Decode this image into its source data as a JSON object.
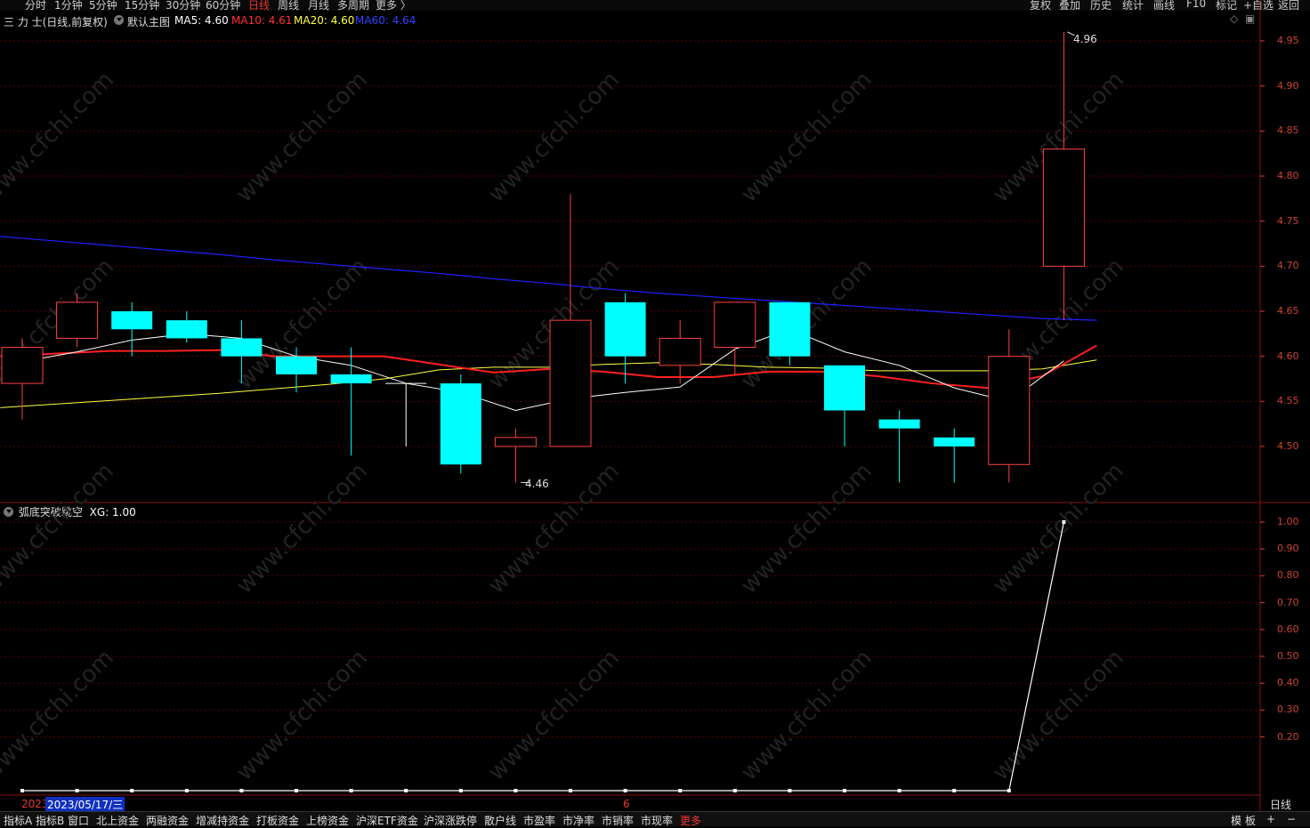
{
  "toolbar": {
    "periods": [
      "分时",
      "1分钟",
      "5分钟",
      "15分钟",
      "30分钟",
      "60分钟",
      "日线",
      "周线",
      "月线",
      "多周期",
      "更多 〉"
    ],
    "active_period": "日线",
    "right_buttons": [
      "复权",
      "叠加",
      "历史",
      "统计",
      "画线",
      "F10",
      "标记",
      "+自选",
      "返回"
    ]
  },
  "stock": {
    "title": "三 力 士(日线,前复权)",
    "main_label": "默认主图",
    "ma5": "MA5: 4.60",
    "ma10": "MA10: 4.61",
    "ma20": "MA20: 4.60",
    "ma60": "MA60: 4.64"
  },
  "indicator": {
    "title": "弧底突破跳空",
    "value": "XG: 1.00"
  },
  "annotations": {
    "high": "4.96",
    "low": "4.46"
  },
  "dates": {
    "left_year": "2023",
    "cursor_date": "2023/05/17/三",
    "month_mark": "6"
  },
  "right_panel": {
    "period_label": "日线"
  },
  "bottom_tabs": [
    "指标A",
    "指标B",
    "窗口",
    "北上资金",
    "两融资金",
    "增减持资金",
    "打板资金",
    "上榜资金",
    "沪深ETF资金",
    "沪深涨跌停",
    "散户线",
    "市盈率",
    "市净率",
    "市销率",
    "市现率",
    "更多"
  ],
  "bottom_right": [
    "模",
    "板",
    "+",
    "−"
  ],
  "watermark": "www.cfchi.com",
  "colors": {
    "up": "#ff4040",
    "down": "#00ffff",
    "ma5": "#ffffff",
    "ma10": "#ff2020",
    "ma20": "#ffff40",
    "ma60": "#2020ff",
    "grid": "#5a0000"
  },
  "chart_data": [
    {
      "type": "candlestick",
      "y_ticks": [
        "4.95",
        "4.90",
        "4.85",
        "4.80",
        "4.75",
        "4.70",
        "4.65",
        "4.60",
        "4.55",
        "4.50"
      ],
      "ylim": [
        4.44,
        4.97
      ],
      "candles": [
        {
          "o": 4.57,
          "c": 4.61,
          "h": 4.62,
          "l": 4.53
        },
        {
          "o": 4.62,
          "c": 4.66,
          "h": 4.67,
          "l": 4.61
        },
        {
          "o": 4.65,
          "c": 4.63,
          "h": 4.66,
          "l": 4.6
        },
        {
          "o": 4.64,
          "c": 4.62,
          "h": 4.65,
          "l": 4.615
        },
        {
          "o": 4.62,
          "c": 4.6,
          "h": 4.64,
          "l": 4.57
        },
        {
          "o": 4.6,
          "c": 4.58,
          "h": 4.61,
          "l": 4.56
        },
        {
          "o": 4.58,
          "c": 4.57,
          "h": 4.61,
          "l": 4.49
        },
        {
          "o": 4.57,
          "c": 4.57,
          "h": 4.57,
          "l": 4.5
        },
        {
          "o": 4.57,
          "c": 4.48,
          "h": 4.58,
          "l": 4.47
        },
        {
          "o": 4.5,
          "c": 4.51,
          "h": 4.52,
          "l": 4.46
        },
        {
          "o": 4.5,
          "c": 4.64,
          "h": 4.78,
          "l": 4.5
        },
        {
          "o": 4.66,
          "c": 4.6,
          "h": 4.67,
          "l": 4.57
        },
        {
          "o": 4.59,
          "c": 4.62,
          "h": 4.64,
          "l": 4.57
        },
        {
          "o": 4.61,
          "c": 4.66,
          "h": 4.66,
          "l": 4.58
        },
        {
          "o": 4.66,
          "c": 4.6,
          "h": 4.66,
          "l": 4.59
        },
        {
          "o": 4.59,
          "c": 4.54,
          "h": 4.59,
          "l": 4.5
        },
        {
          "o": 4.53,
          "c": 4.52,
          "h": 4.54,
          "l": 4.46
        },
        {
          "o": 4.51,
          "c": 4.5,
          "h": 4.52,
          "l": 4.46
        },
        {
          "o": 4.48,
          "c": 4.6,
          "h": 4.63,
          "l": 4.46
        },
        {
          "o": 4.7,
          "c": 4.83,
          "h": 4.96,
          "l": 4.64
        }
      ],
      "ma5": [
        4.594,
        4.605,
        4.618,
        4.625,
        4.62,
        4.6,
        4.59,
        4.57,
        4.56,
        4.54,
        4.553,
        4.56,
        4.566,
        4.608,
        4.63,
        4.605,
        4.59,
        4.565,
        4.55,
        4.595
      ],
      "ma10": [
        4.6,
        4.603,
        4.606,
        4.606,
        4.607,
        4.6,
        4.6,
        4.6,
        4.591,
        4.582,
        4.586,
        4.583,
        4.577,
        4.577,
        4.583,
        4.583,
        4.578,
        4.57,
        4.565,
        4.578,
        4.612
      ],
      "ma20": [
        4.543,
        4.547,
        4.551,
        4.555,
        4.559,
        4.564,
        4.569,
        4.575,
        4.585,
        4.588,
        4.588,
        4.591,
        4.593,
        4.591,
        4.588,
        4.587,
        4.584,
        4.584,
        4.584,
        4.586,
        4.596
      ],
      "ma60": [
        4.733,
        4.728,
        4.723,
        4.718,
        4.713,
        4.707,
        4.702,
        4.697,
        4.692,
        4.686,
        4.681,
        4.675,
        4.67,
        4.666,
        4.662,
        4.658,
        4.654,
        4.65,
        4.646,
        4.642,
        4.64
      ]
    },
    {
      "type": "line",
      "title": "弧底突破跳空",
      "y_ticks": [
        "1.00",
        "0.90",
        "0.80",
        "0.70",
        "0.60",
        "0.50",
        "0.40",
        "0.30",
        "0.20"
      ],
      "ylim": [
        0,
        1.0
      ],
      "series": [
        {
          "name": "XG",
          "values": [
            0,
            0,
            0,
            0,
            0,
            0,
            0,
            0,
            0,
            0,
            0,
            0,
            0,
            0,
            0,
            0,
            0,
            0,
            0,
            1
          ]
        }
      ]
    }
  ]
}
